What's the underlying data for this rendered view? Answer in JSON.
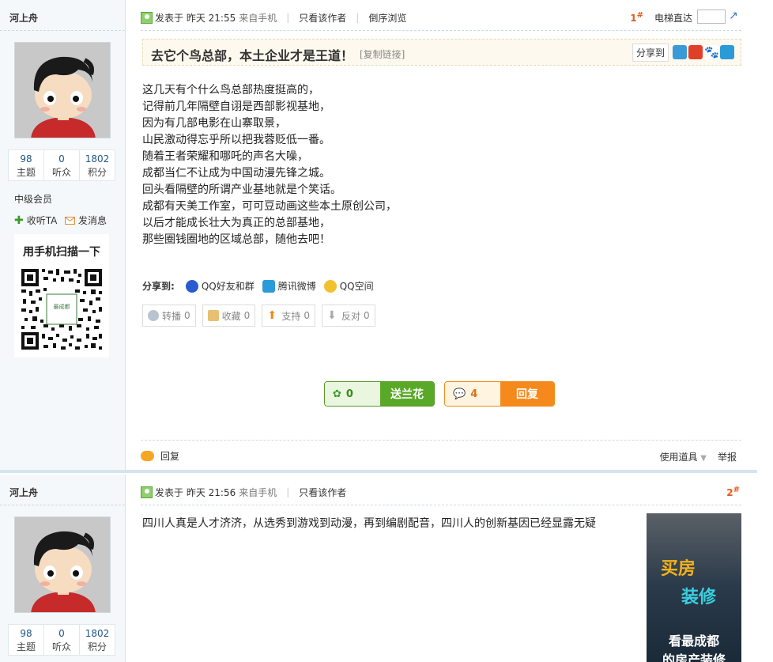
{
  "post1": {
    "author": "河上舟",
    "stats": [
      {
        "num": "98",
        "label": "主题"
      },
      {
        "num": "0",
        "label": "听众"
      },
      {
        "num": "1802",
        "label": "积分"
      }
    ],
    "level": "中级会员",
    "follow_label": "收听TA",
    "message_label": "发消息",
    "qr_title": "用手机扫描一下",
    "qr_caption": "最成都",
    "topbar": {
      "posted": "发表于 昨天 21:55",
      "source": "来自手机",
      "only_author": "只看该作者",
      "reverse": "倒序浏览",
      "floor": "1",
      "elevator": "电梯直达"
    },
    "title": "去它个鸟总部，本土企业才是王道！",
    "copy_link": "[复制链接]",
    "share_to": "分享到",
    "content_lines": [
      "这几天有个什么鸟总部热度挺高的，",
      "记得前几年隔壁自诩是西部影视基地，",
      "因为有几部电影在山寨取景，",
      "山民激动得忘乎所以把我蓉贬低一番。",
      "随着王者荣耀和哪吒的声名大噪，",
      "成都当仁不让成为中国动漫先锋之城。",
      "回头看隔壁的所谓产业基地就是个笑话。",
      "成都有天美工作室，可可豆动画这些本土原创公司，",
      "以后才能成长壮大为真正的总部基地，",
      "那些圈钱圈地的区域总部，随他去吧！"
    ],
    "share_row": {
      "label": "分享到:",
      "qq": "QQ好友和群",
      "weibo": "腾讯微博",
      "qzone": "QQ空间"
    },
    "actions": [
      {
        "label": "转播",
        "count": "0"
      },
      {
        "label": "收藏",
        "count": "0"
      },
      {
        "label": "支持",
        "count": "0"
      },
      {
        "label": "反对",
        "count": "0"
      }
    ],
    "flower_count": "0",
    "flower_label": "送兰花",
    "reply_count": "4",
    "reply_label": "回复",
    "reply_link": "回复",
    "tools": "使用道具",
    "report": "举报"
  },
  "post2": {
    "author": "河上舟",
    "stats": [
      {
        "num": "98",
        "label": "主题"
      },
      {
        "num": "0",
        "label": "听众"
      },
      {
        "num": "1802",
        "label": "积分"
      }
    ],
    "topbar": {
      "posted": "发表于 昨天 21:56",
      "source": "来自手机",
      "only_author": "只看该作者",
      "floor": "2"
    },
    "content": "四川人真是人才济济，从选秀到游戏到动漫，再到编剧配音，四川人的创新基因已经显露无疑",
    "ad": {
      "line1": "买房",
      "line2": "装修",
      "line3": "看最成都",
      "line4": "的房产装修"
    }
  },
  "colors": {
    "accent_green": "#5aa828",
    "accent_orange": "#f5891c",
    "floor_red": "#e05a1a",
    "link_blue": "#225588"
  }
}
